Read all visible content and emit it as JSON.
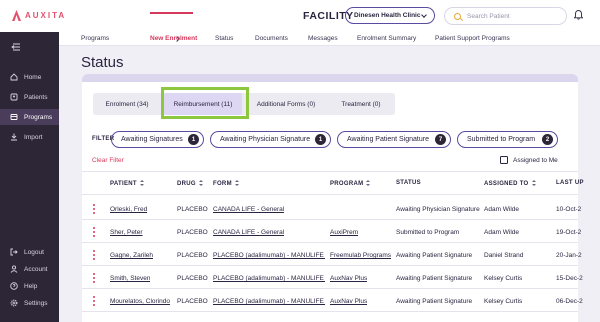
{
  "header": {
    "logo_text": "AUXITA",
    "facility_label": "FACILITY",
    "facility_value": "Dinesen Health Clinic",
    "search_placeholder": "Search Patient"
  },
  "sidebar": {
    "items": [
      {
        "label": "Home",
        "icon": "home-icon"
      },
      {
        "label": "Patients",
        "icon": "patients-icon"
      },
      {
        "label": "Programs",
        "icon": "programs-icon",
        "active": true
      },
      {
        "label": "Import",
        "icon": "import-icon"
      },
      {
        "label": "Logout",
        "icon": "logout-icon"
      },
      {
        "label": "Account",
        "icon": "account-icon"
      },
      {
        "label": "Help",
        "icon": "help-icon"
      },
      {
        "label": "Settings",
        "icon": "settings-icon"
      }
    ]
  },
  "subnav": {
    "items": [
      "Programs",
      "New Enrolment",
      "Status",
      "Documents",
      "Messages",
      "Enrolment Summary",
      "Patient Support Programs"
    ],
    "active": "New Enrolment"
  },
  "page_title": "Status",
  "tabs": [
    {
      "label": "Enrolment (34)"
    },
    {
      "label": "Reimbursement (11)",
      "active": true
    },
    {
      "label": "Additional Forms (0)"
    },
    {
      "label": "Treatment (0)"
    }
  ],
  "filter": {
    "label": "FILTER",
    "chips": [
      {
        "label": "Awaiting Signatures",
        "count": "1"
      },
      {
        "label": "Awaiting Physician Signature",
        "count": "1"
      },
      {
        "label": "Awaiting Patient Signature",
        "count": "7"
      },
      {
        "label": "Submitted to Program",
        "count": "2"
      }
    ],
    "clear_label": "Clear Filter",
    "assigned_to_me_label": "Assigned to Me"
  },
  "table": {
    "columns": [
      "PATIENT",
      "DRUG",
      "FORM",
      "PROGRAM",
      "STATUS",
      "ASSIGNED TO",
      "LAST UP"
    ],
    "rows": [
      {
        "patient": "Orleski, Fred",
        "drug": "PLACEBO",
        "form": "CANADA LIFE - General",
        "program": "",
        "status": "Awaiting Physician Signature",
        "assigned": "Adam Wilde",
        "last": "10-Oct-2"
      },
      {
        "patient": "Sher, Peter",
        "drug": "PLACEBO",
        "form": "CANADA LIFE - General",
        "program": "AuxiPrem",
        "status": "Submitted to Program",
        "assigned": "Adam Wilde",
        "last": "19-Oct-2"
      },
      {
        "patient": "Gagne, Zarileh",
        "drug": "PLACEBO",
        "form": "PLACEBO (adalimumab) - MANULIFE D...",
        "program": "Freemulab Programs",
        "status": "Awaiting Patient Signature",
        "assigned": "Daniel Strand",
        "last": "20-Jan-2"
      },
      {
        "patient": "Smith, Steven",
        "drug": "PLACEBO",
        "form": "PLACEBO (adalimumab) - MANULIFE D...",
        "program": "AuxNav Plus",
        "status": "Awaiting Patient Signature",
        "assigned": "Kelsey Curtis",
        "last": "15-Dec-2"
      },
      {
        "patient": "Mourelatos, Clorindo",
        "drug": "PLACEBO",
        "form": "PLACEBO (adalimumab) - MANULIFE D...",
        "program": "AuxNav Plus",
        "status": "Awaiting Patient Signature",
        "assigned": "Kelsey Curtis",
        "last": "06-Dec-2"
      }
    ]
  },
  "colors": {
    "accent": "#d6385b",
    "sidebar_bg": "#2d2637",
    "chip_border": "#5a4aa0",
    "highlight": "#8dc63f"
  }
}
